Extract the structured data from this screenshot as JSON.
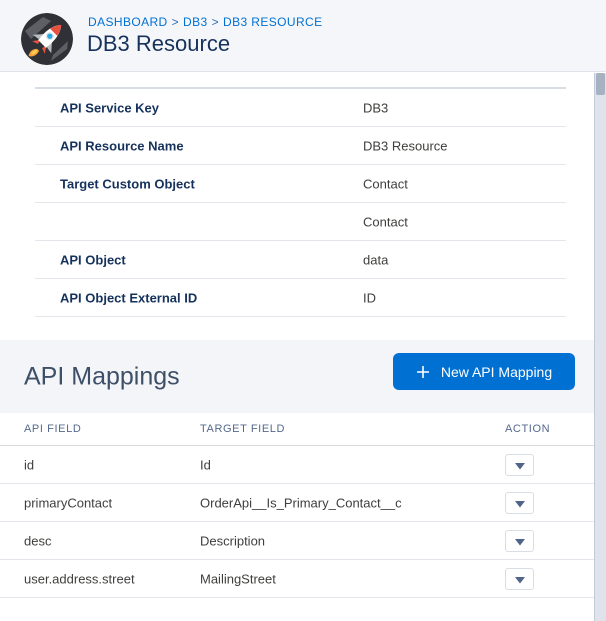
{
  "header": {
    "breadcrumb": {
      "items": [
        "DASHBOARD",
        "DB3",
        "DB3 RESOURCE"
      ],
      "separator": ">"
    },
    "title": "DB3 Resource",
    "avatar_icon": "rocket-icon"
  },
  "details": {
    "rows": [
      {
        "label": "API Service Key",
        "value": "DB3"
      },
      {
        "label": "API Resource Name",
        "value": "DB3 Resource"
      },
      {
        "label": "Target Custom Object",
        "value": "Contact"
      },
      {
        "label": "",
        "value": "Contact"
      },
      {
        "label": "API Object",
        "value": "data"
      },
      {
        "label": "API Object External ID",
        "value": "ID"
      }
    ]
  },
  "mappings": {
    "title": "API Mappings",
    "new_button": {
      "label": "New API Mapping",
      "icon": "plus-icon"
    },
    "table": {
      "columns": [
        "API FIELD",
        "TARGET FIELD",
        "ACTION"
      ],
      "rows": [
        {
          "api_field": "id",
          "target_field": "Id",
          "action_icon": "dropdown-triangle-icon"
        },
        {
          "api_field": "primaryContact",
          "target_field": "OrderApi__Is_Primary_Contact__c",
          "action_icon": "dropdown-triangle-icon"
        },
        {
          "api_field": "desc",
          "target_field": "Description",
          "action_icon": "dropdown-triangle-icon"
        },
        {
          "api_field": "user.address.street",
          "target_field": "MailingStreet",
          "action_icon": "dropdown-triangle-icon"
        }
      ]
    }
  },
  "colors": {
    "accent_blue": "#0070d2",
    "header_background": "#f4f6fa",
    "section_background": "#f3f5f9",
    "title_navy": "#16325c",
    "table_header_text": "#54698d",
    "body_text": "#3e3e3c",
    "divider": "#e3e6eb",
    "scrollbar_thumb": "#a6b2c2"
  }
}
